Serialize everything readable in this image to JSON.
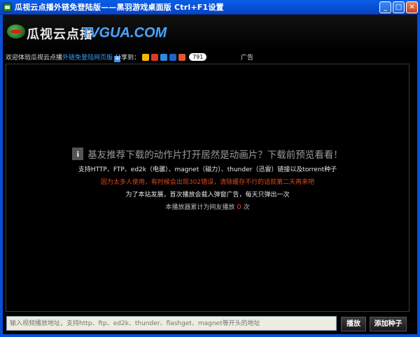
{
  "window": {
    "title": "瓜视云点播外链免登陆版——黑羽游戏桌面版 Ctrl+F1设置",
    "buttons": {
      "minimize": "_",
      "maximize": "□",
      "close": "✕"
    }
  },
  "header": {
    "logo_cn": "瓜视云点播",
    "logo_en": "TVGUA.COM"
  },
  "infobar": {
    "welcome_text": "欢迎体验瓜视云点播",
    "welcome_link": "外链免登陆网页版",
    "plus_symbol": "+",
    "share_label": "分享到：",
    "share_icons": [
      "qzone-icon",
      "renren-icon",
      "kaixin-icon",
      "douban-icon",
      "weibo-icon"
    ],
    "share_count": "791",
    "ad_text": "广告"
  },
  "player": {
    "info_glyph": "i",
    "headline": "基友推荐下载的动作片打开居然是动画片？下载前预览看看！",
    "support_line": "支持HTTP、FTP、ed2k（电骡）、magnet（磁力）、thunder（迅雷）链接以及torrent种子",
    "warning_line": "因为太多人使用，有时候会出现302错误，清除缓存不行的话就第二天再来吧",
    "ad_notice_line": "为了本站发展，首次播放会载入弹窗广告，每天只弹出一次",
    "count_prefix": "本播放器累计为网友播放",
    "count_value": "0",
    "count_suffix": "次"
  },
  "bottombar": {
    "input_placeholder": "输入视频播放地址，支持http、ftp、ed2k、thunder、flashget、magnet等开头的地址",
    "play_button": "播放",
    "add_seed_button": "添加种子"
  },
  "colors": {
    "titlebar": "#0a5fe8",
    "link": "#3aa0ff",
    "warning": "#e0481e",
    "background": "#000000"
  }
}
